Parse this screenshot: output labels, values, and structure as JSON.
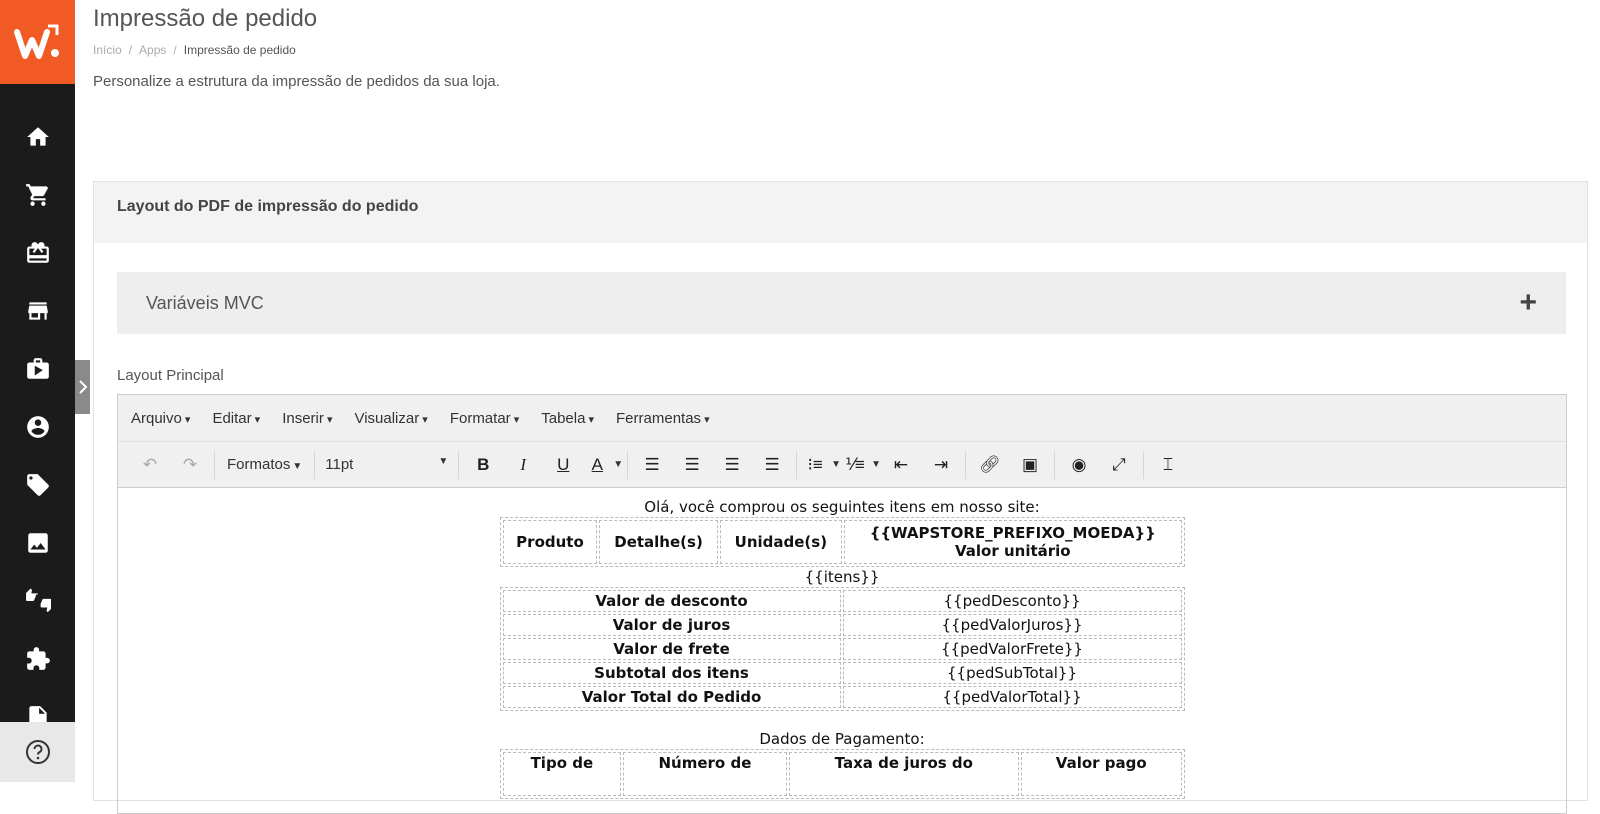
{
  "header": {
    "title": "Impressão de pedido",
    "breadcrumb": [
      "Início",
      "Apps",
      "Impressão de pedido"
    ],
    "description": "Personalize a estrutura da impressão de pedidos da sua loja."
  },
  "panel": {
    "title": "Layout do PDF de impressão do pedido",
    "accordion_label": "Variáveis MVC",
    "field_label": "Layout Principal"
  },
  "editor": {
    "menu": [
      "Arquivo",
      "Editar",
      "Inserir",
      "Visualizar",
      "Formatar",
      "Tabela",
      "Ferramentas"
    ],
    "formats_label": "Formatos",
    "font_size": "11pt"
  },
  "content": {
    "intro": "Olá, você comprou os seguintes itens em nosso site:",
    "items_header": [
      "Produto",
      "Detalhe(s)",
      "Unidade(s)",
      "{{WAPSTORE_PREFIXO_MOEDA}}",
      "Valor unitário"
    ],
    "items_placeholder": "{{itens}}",
    "totals": [
      {
        "label": "Valor de desconto",
        "value": "{{pedDesconto}}"
      },
      {
        "label": "Valor de juros",
        "value": "{{pedValorJuros}}"
      },
      {
        "label": "Valor de frete",
        "value": "{{pedValorFrete}}"
      },
      {
        "label": "Subtotal dos itens",
        "value": "{{pedSubTotal}}"
      },
      {
        "label": "Valor Total do Pedido",
        "value": "{{pedValorTotal}}"
      }
    ],
    "payment_title": "Dados de Pagamento:",
    "payment_header": [
      "Tipo de",
      "Número de",
      "Taxa de juros do",
      "Valor pago"
    ]
  }
}
